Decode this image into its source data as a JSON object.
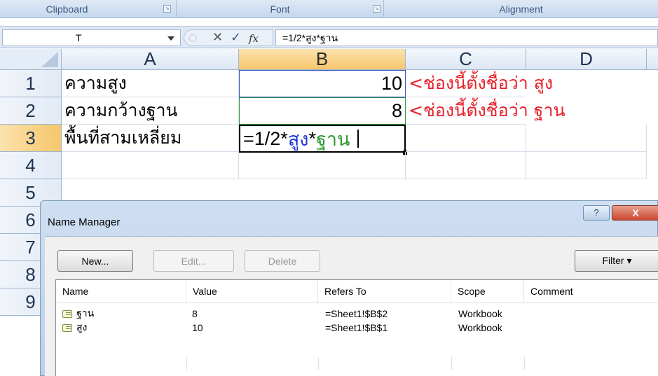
{
  "ribbon": {
    "groups": [
      {
        "label": "Clipboard"
      },
      {
        "label": "Font"
      },
      {
        "label": "Alignment"
      }
    ]
  },
  "formula_bar": {
    "name_box": "T",
    "cancel_glyph": "✕",
    "enter_glyph": "✓",
    "fx_label": "fx",
    "formula": "=1/2*สูง*ฐาน"
  },
  "sheet": {
    "columns": [
      "A",
      "B",
      "C",
      "D"
    ],
    "rows": [
      "1",
      "2",
      "3",
      "4",
      "5",
      "6",
      "7",
      "8",
      "9"
    ],
    "selected_column": "B",
    "selected_row": "3",
    "cells": {
      "A1": "ความสูง",
      "A2": "ความกว้างฐาน",
      "A3": "พื้นที่สามเหลี่ยม",
      "B1": "10",
      "B2": "8",
      "B3_prefix": "=1/2*",
      "B3_ref1": "สูง",
      "B3_op": "*",
      "B3_ref2": "ฐาน",
      "C1_note": "<ช่องนี้ตั้งชื่อว่า สูง",
      "C2_note": "<ช่องนี้ตั้งชื่อว่า ฐาน"
    },
    "colors": {
      "ref1": "#1f37d6",
      "ref2": "#2a9b31",
      "note": "#e8202a"
    }
  },
  "name_manager": {
    "title": "Name Manager",
    "help_label": "?",
    "close_label": "X",
    "buttons": {
      "new": "New...",
      "edit": "Edit...",
      "delete": "Delete",
      "filter": "Filter ▾"
    },
    "columns": [
      "Name",
      "Value",
      "Refers To",
      "Scope",
      "Comment"
    ],
    "rows": [
      {
        "name": "ฐาน",
        "value": "8",
        "refers_to": "=Sheet1!$B$2",
        "scope": "Workbook",
        "comment": ""
      },
      {
        "name": "สูง",
        "value": "10",
        "refers_to": "=Sheet1!$B$1",
        "scope": "Workbook",
        "comment": ""
      }
    ]
  }
}
